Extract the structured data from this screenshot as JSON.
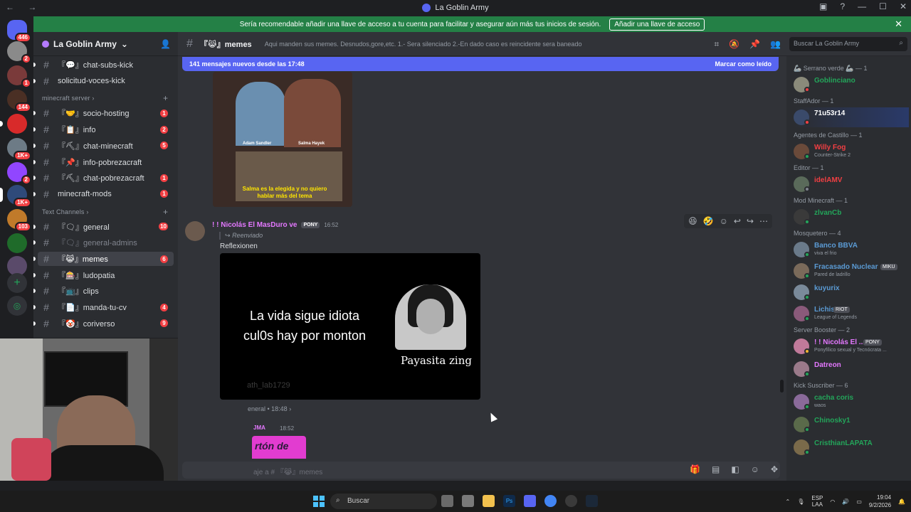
{
  "window": {
    "title": "La Goblin Army"
  },
  "notice": {
    "text": "Sería recomendable añadir una llave de acceso a tu cuenta para facilitar y asegurar aún más tus inicios de sesión.",
    "button": "Añadir una llave de acceso"
  },
  "rail": {
    "badges": [
      "446",
      "2",
      "1",
      "144",
      "1K+",
      "2",
      "1K+",
      "103"
    ]
  },
  "guild": {
    "name": "La Goblin Army"
  },
  "sidebar": {
    "channels_top": [
      {
        "name": "『💬』chat-subs-kick",
        "badge": ""
      },
      {
        "name": "solicitud-voces-kick",
        "badge": ""
      }
    ],
    "category_mc": "minecraft server",
    "channels_mc": [
      {
        "name": "『🤝』socio-hosting",
        "badge": "1"
      },
      {
        "name": "『📋』info",
        "badge": "2"
      },
      {
        "name": "『⛏』chat-minecraft",
        "badge": "5"
      },
      {
        "name": "『📌』info-pobrezacraft",
        "badge": ""
      },
      {
        "name": "『⛏』chat-pobrezacraft",
        "badge": "1"
      },
      {
        "name": "minecraft-mods",
        "badge": "1"
      }
    ],
    "category_text": "Text Channels",
    "channels_text": [
      {
        "name": "『🗨』general",
        "badge": "10"
      },
      {
        "name": "『🗨』general-admins",
        "badge": ""
      },
      {
        "name": "『😹』memes",
        "badge": "6"
      },
      {
        "name": "『🎰』ludopatia",
        "badge": ""
      },
      {
        "name": "『📺』clips",
        "badge": ""
      },
      {
        "name": "『📄』manda-tu-cv",
        "badge": "4"
      },
      {
        "name": "『🤡』coriverso",
        "badge": "9"
      }
    ]
  },
  "chat": {
    "channel": "『😹』memes",
    "topic": "Aqui manden sus memes. Desnudos,gore,etc. 1.- Sera silenciado 2.-En dado caso es reincidente sera baneado",
    "new_bar": "141 mensajes nuevos desde las 17:48",
    "mark_read": "Marcar como leído",
    "meme1_caption": "Salma es la elegida y no quiero hablar más del tema",
    "meme1_label1": "Adam Sandler",
    "meme1_label2": "Salma Hayek",
    "msg": {
      "author": "! ! Nicolás El MasDuro ve",
      "tag": "PONY",
      "time": "16:52",
      "forwarded": "Reenviado",
      "body": "Reflexionen",
      "embed_line1": "La vida sigue idiota",
      "embed_line2": "cul0s hay por monton",
      "embed_sign": "Payasita zing",
      "embed_wm": "ath_lab1729",
      "source": "eneral • 18:48 ›"
    },
    "msg3": {
      "author": "JMA",
      "time": "18:52",
      "sticker": "rtón de"
    },
    "composer_placeholder": "aje a # 『😹』memes"
  },
  "search": {
    "placeholder": "Buscar La Goblin Army"
  },
  "members": [
    {
      "role": "🦾 Serrano verde 🦾 — 1",
      "name": "Goblinciano",
      "sub": "",
      "color": "#23a55a"
    },
    {
      "role": "StaffAdor — 1",
      "name": "71u53r14",
      "sub": "",
      "color": "#ffffff"
    },
    {
      "role": "Agentes de Castillo — 1",
      "name": "Willy Fog",
      "sub": "Counter-Strike 2",
      "color": "#f23f43"
    },
    {
      "role": "Editor — 1",
      "name": "idelAMV",
      "sub": "",
      "color": "#f23f43"
    },
    {
      "role": "Mod Minecraft — 1",
      "name": "zlvanCb",
      "sub": "",
      "color": "#23a55a"
    },
    {
      "role": "Mosquetero — 4",
      "name": "Banco BBVA",
      "sub": "viva el frio",
      "color": "#5b9bd5"
    },
    {
      "role": "",
      "name": "Fracasado Nuclear",
      "sub": "Pared de ladrillo",
      "color": "#5b9bd5"
    },
    {
      "role": "",
      "name": "kuyurix",
      "sub": "",
      "color": "#5b9bd5"
    },
    {
      "role": "",
      "name": "Lichis",
      "sub": "League of Legends",
      "color": "#5b9bd5"
    },
    {
      "role": "Server Booster — 2",
      "name": "! ! Nicolás El ...",
      "sub": "Ponyfílico sexual y Tecnócrata ...",
      "color": "#e478ff"
    },
    {
      "role": "",
      "name": "Datreon",
      "sub": "",
      "color": "#e478ff"
    },
    {
      "role": "Kick Suscriber — 6",
      "name": "cacha coris",
      "sub": "waos",
      "color": "#23a55a"
    },
    {
      "role": "",
      "name": "Chinosky1",
      "sub": "",
      "color": "#23a55a"
    },
    {
      "role": "",
      "name": "CristhianLAPATA",
      "sub": "",
      "color": "#23a55a"
    }
  ],
  "member_tags": {
    "fracasado": "MIKU",
    "lichis": "RIOT",
    "nicolas": "PONY"
  },
  "taskbar": {
    "search": "Buscar",
    "lang": "ESP",
    "lang2": "LAA",
    "time": "19:04",
    "date": "9/2/2026"
  }
}
